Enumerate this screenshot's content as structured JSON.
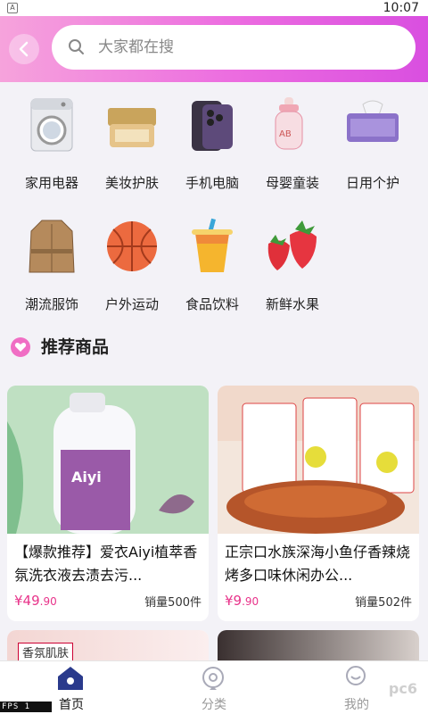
{
  "status_bar": {
    "time": "10:07",
    "notification_icon": "A"
  },
  "search": {
    "placeholder": "大家都在搜"
  },
  "categories": [
    {
      "label": "家用电器",
      "icon": "washing-machine"
    },
    {
      "label": "美妆护肤",
      "icon": "cream-jar"
    },
    {
      "label": "手机电脑",
      "icon": "smartphone"
    },
    {
      "label": "母婴童装",
      "icon": "baby-bottle"
    },
    {
      "label": "日用个护",
      "icon": "tissue-box"
    },
    {
      "label": "潮流服饰",
      "icon": "trench-coat"
    },
    {
      "label": "户外运动",
      "icon": "basketball"
    },
    {
      "label": "食品饮料",
      "icon": "drink-cup"
    },
    {
      "label": "新鲜水果",
      "icon": "strawberry"
    }
  ],
  "section": {
    "title": "推荐商品",
    "icon": "heart-icon"
  },
  "products": [
    {
      "title": "【爆款推荐】爱衣Aiyi植萃香氛洗衣液去渍去污...",
      "currency": "¥",
      "price_int": "49",
      "price_dec": ".90",
      "sold": "销量500件"
    },
    {
      "title": "正宗口水族深海小鱼仔香辣烧烤多口味休闲办公...",
      "currency": "¥",
      "price_int": "9",
      "price_dec": ".90",
      "sold": "销量502件"
    }
  ],
  "next_card": {
    "tag": "香氛肌肤"
  },
  "tabs": [
    {
      "label": "首页",
      "active": true
    },
    {
      "label": "分类",
      "active": false
    },
    {
      "label": "我的",
      "active": false
    }
  ],
  "overlay": {
    "fps": "FPS 1",
    "watermark": "pc6"
  },
  "colors": {
    "accent": "#e8338a",
    "header_start": "#f6a3dc",
    "header_end": "#d94fe0",
    "tab_active": "#2a3a8c"
  }
}
